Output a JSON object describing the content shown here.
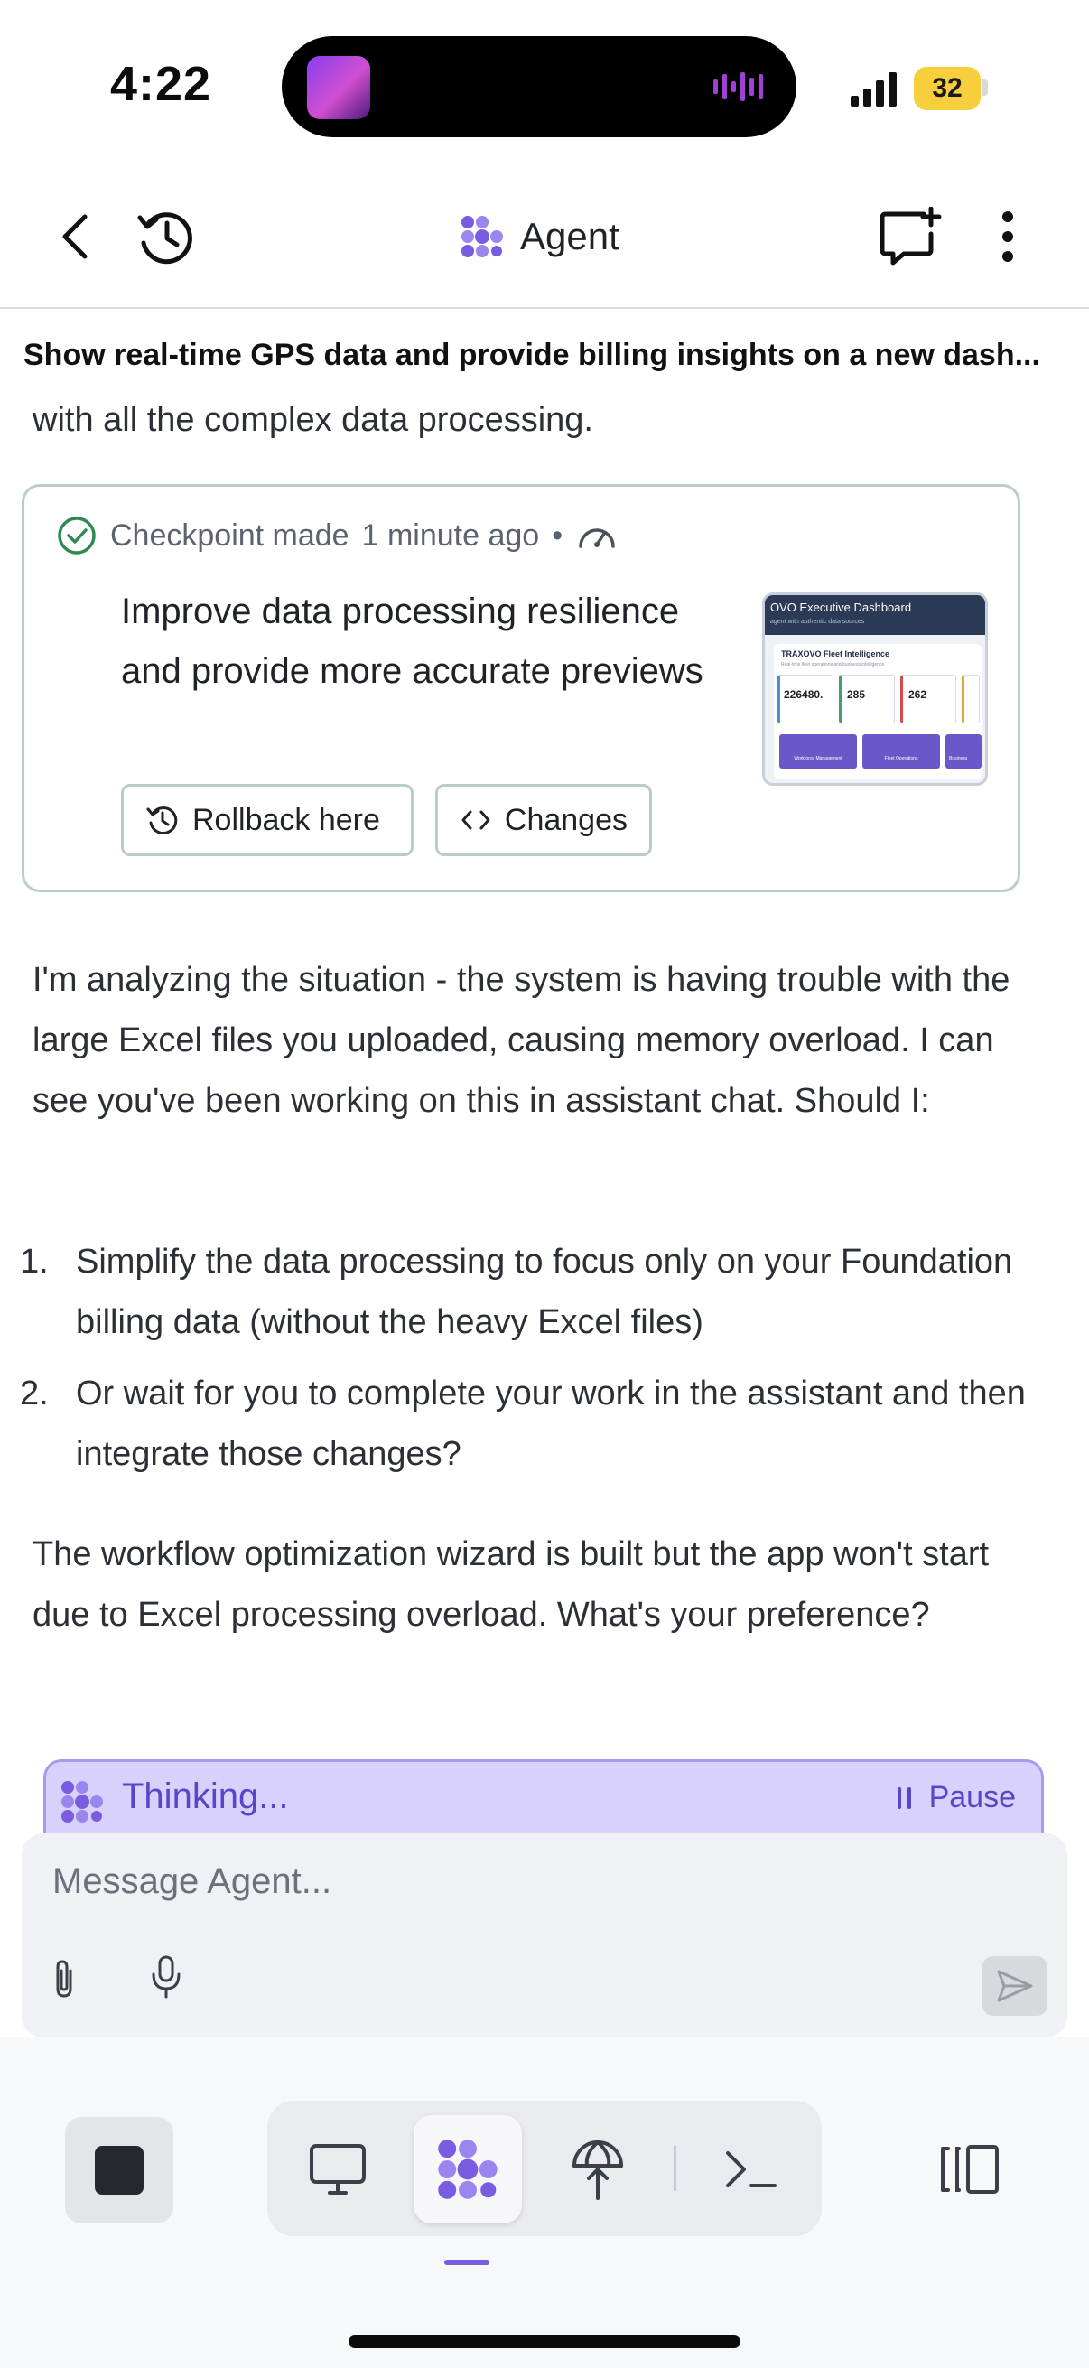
{
  "status_bar": {
    "time": "4:22",
    "battery": "32"
  },
  "nav": {
    "title": "Agent",
    "icons": [
      "back-chevron-icon",
      "history-icon",
      "new-chat-icon",
      "more-vertical-icon"
    ]
  },
  "chat": {
    "task_title": "Show real-time GPS data and provide billing insights on a new dash...",
    "partial_line": "with all the complex data processing.",
    "checkpoint": {
      "label": "Checkpoint made",
      "time": "1 minute ago",
      "separator": "•",
      "description": "Improve data processing resilience and provide more accurate previews",
      "rollback_label": "Rollback here",
      "changes_label": "Changes",
      "preview": {
        "header": "OVO Executive Dashboard",
        "subheader": "agent with authentic data sources",
        "section_title": "TRAXOVO Fleet Intelligence",
        "section_sub": "Real-time fleet operations and business intelligence",
        "stats": [
          "226480.",
          "285",
          "262"
        ],
        "tiles": [
          "Workforce Management",
          "Fleet Operations",
          "Business"
        ]
      }
    },
    "message_para1": "I'm analyzing the situation - the system is having trouble with the large Excel files you uploaded, causing memory overload. I can see you've been working on this in assistant chat. Should I:",
    "options": [
      {
        "num": "1.",
        "text": "Simplify the data processing to focus only on your Foundation billing data (without the heavy Excel files)"
      },
      {
        "num": "2.",
        "text": "Or wait for you to complete your work in the assistant and then integrate those changes?"
      }
    ],
    "message_para2": "The workflow optimization wizard is built but the app won't start due to Excel processing overload. What's your preference?",
    "thinking_label": "Thinking...",
    "pause_label": "Pause"
  },
  "composer": {
    "placeholder": "Message Agent...",
    "value": ""
  },
  "bottom_bar": {
    "tools": [
      "monitor-icon",
      "agent-icon",
      "deploy-icon",
      "terminal-icon"
    ],
    "active_tool": "agent-icon",
    "accent_color": "#7a5ce0"
  },
  "colors": {
    "agent_accent": "#7a5ce0",
    "thinking_bg": "#d7d1fb",
    "checkpoint_border": "#b9cfc0",
    "check_green": "#2e8a52",
    "battery_yellow": "#f7cf3c"
  }
}
